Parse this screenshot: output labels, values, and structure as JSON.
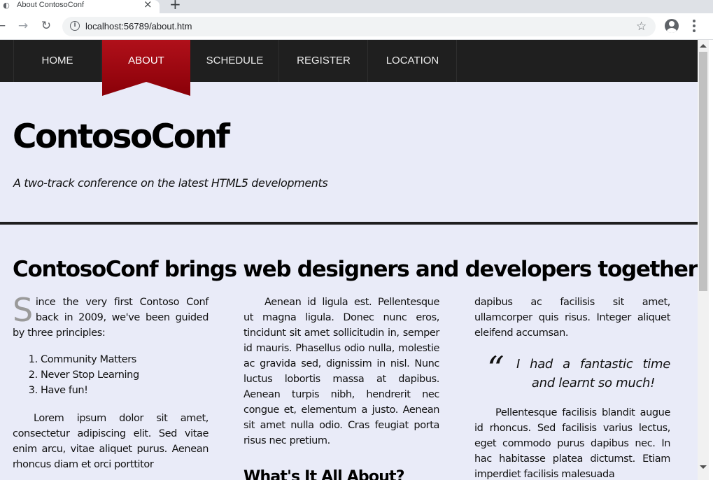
{
  "browser": {
    "tab_title": "About ContosoConf",
    "tab_close": "×",
    "new_tab": "+",
    "url": "localhost:56789/about.htm",
    "back_glyph": "←",
    "forward_glyph": "→",
    "reload_glyph": "↻",
    "info_glyph": "i",
    "star_glyph": "☆",
    "icons": [
      "favicon-icon",
      "close-icon",
      "plus-icon",
      "back-arrow-icon",
      "forward-arrow-icon",
      "reload-icon",
      "info-icon",
      "star-icon",
      "account-icon",
      "kebab-menu-icon"
    ]
  },
  "nav": {
    "items": [
      {
        "label": "HOME"
      },
      {
        "label": "ABOUT"
      },
      {
        "label": "SCHEDULE"
      },
      {
        "label": "REGISTER"
      },
      {
        "label": "LOCATION"
      }
    ],
    "active": "ABOUT"
  },
  "header": {
    "title": "ContosoConf",
    "tagline": "A two-track conference on the latest HTML5 developments"
  },
  "main": {
    "heading": "ContosoConf brings web designers and developers together",
    "dropcap": "S",
    "intro": "ince the very first Contoso Conf back in 2009, we've been guided by three principles:",
    "principles": [
      "Community Matters",
      "Never Stop Learning",
      "Have fun!"
    ],
    "para1": "Lorem ipsum dolor sit amet, consectetur adipiscing elit. Sed vitae enim arcu, vitae aliquet purus. Aenean rhoncus diam et orci porttitor",
    "para2": "Aenean id ligula est. Pellentesque ut magna ligula. Donec nunc eros, tincidunt sit amet sollicitudin in, semper id mauris. Phasellus odio nulla, molestie ac gravida sed, dignissim in nisl. Nunc luctus lobortis massa at dapibus. Aenean turpis nibh, hendrerit nec congue et, elementum a justo. Aenean sit amet nulla odio. Cras feugiat porta risus nec pretium.",
    "subheading": "What's It All About?",
    "para3": "dapibus ac facilisis sit amet, ullamcorper quis risus. Integer aliquet eleifend accumsan.",
    "quote_mark": "“",
    "quote": "I had a fantastic time and learnt so much!",
    "para4": "Pellentesque facilisis blandit augue id rhoncus. Sed facilisis varius lectus, eget commodo purus dapibus nec. In hac habitasse platea dictumst. Etiam imperdiet facilisis malesuada"
  },
  "colors": {
    "nav_bg": "#1f1f1f",
    "active_tab": "#a3000e",
    "page_bg": "#e9ebf8",
    "dropcap": "#9a9a9a"
  }
}
